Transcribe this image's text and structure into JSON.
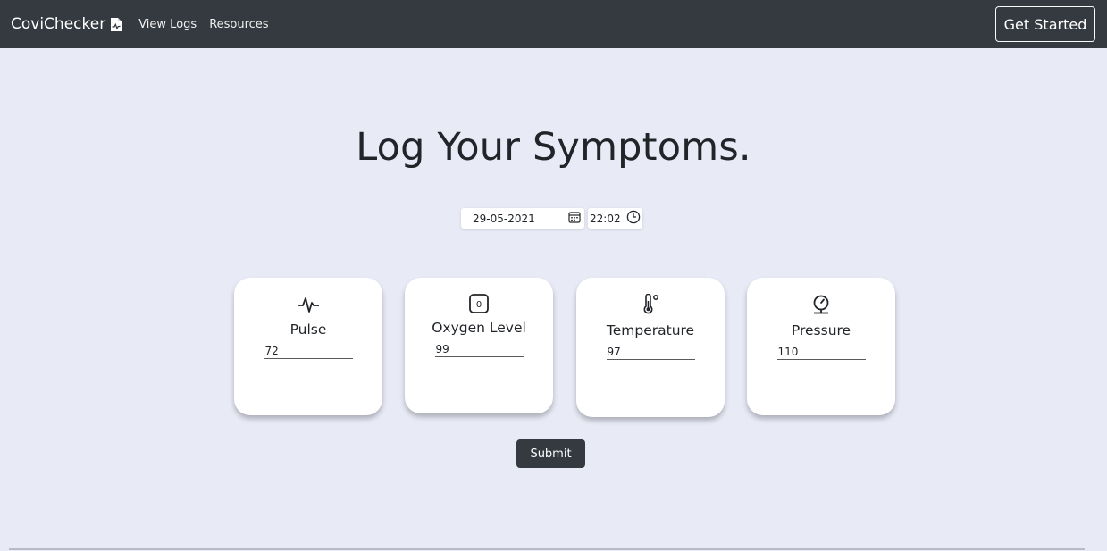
{
  "navbar": {
    "brand": "CoviChecker",
    "links": [
      "View Logs",
      "Resources"
    ],
    "cta": "Get Started"
  },
  "main": {
    "title": "Log Your Symptoms.",
    "date": "29-05-2021",
    "time": "22:02",
    "submit": "Submit"
  },
  "cards": [
    {
      "label": "Pulse",
      "value": "72",
      "icon": "pulse-icon"
    },
    {
      "label": "Oxygen Level",
      "value": "99",
      "icon": "oxygen-icon"
    },
    {
      "label": "Temperature",
      "value": "97",
      "icon": "thermometer-icon"
    },
    {
      "label": "Pressure",
      "value": "110",
      "icon": "pressure-gauge-icon"
    }
  ],
  "colors": {
    "navbar": "#343a40",
    "background": "#e8eaf6",
    "card": "#ffffff"
  }
}
